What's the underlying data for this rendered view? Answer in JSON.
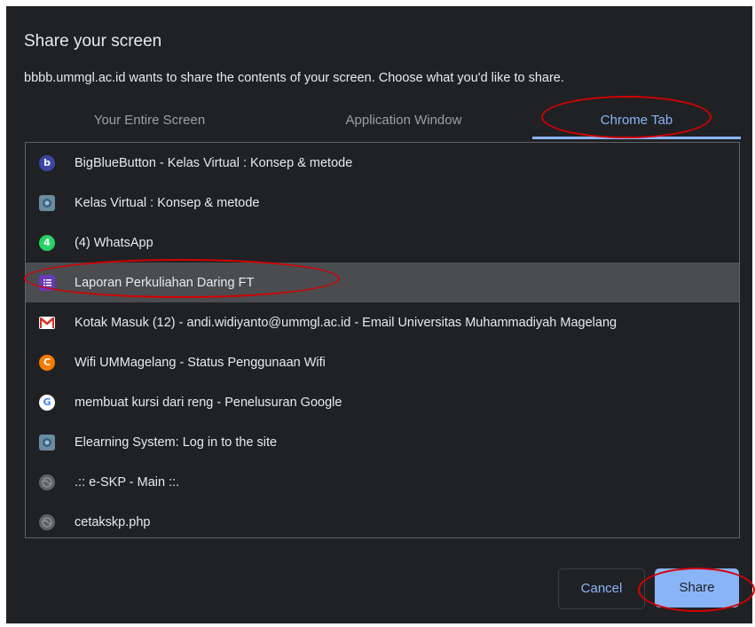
{
  "dialog": {
    "title": "Share your screen",
    "subtitle": "bbbb.ummgl.ac.id wants to share the contents of your screen. Choose what you'd like to share."
  },
  "tabs": [
    {
      "label": "Your Entire Screen",
      "active": false
    },
    {
      "label": "Application Window",
      "active": false
    },
    {
      "label": "Chrome Tab",
      "active": true
    }
  ],
  "tab_list": [
    {
      "label": "BigBlueButton - Kelas Virtual : Konsep & metode",
      "icon": "bigbluebutton-icon",
      "selected": false
    },
    {
      "label": "Kelas Virtual : Konsep & metode",
      "icon": "moodle-site-icon",
      "selected": false
    },
    {
      "label": "(4) WhatsApp",
      "icon": "whatsapp-icon",
      "selected": false
    },
    {
      "label": "Laporan Perkuliahan Daring FT",
      "icon": "google-forms-icon",
      "selected": true
    },
    {
      "label": "Kotak Masuk (12) - andi.widiyanto@ummgl.ac.id - Email Universitas Muhammadiyah Magelang",
      "icon": "gmail-icon",
      "selected": false
    },
    {
      "label": "Wifi UMMagelang - Status Penggunaan Wifi",
      "icon": "wifi-portal-icon",
      "selected": false
    },
    {
      "label": "membuat kursi dari reng - Penelusuran Google",
      "icon": "google-icon",
      "selected": false
    },
    {
      "label": "Elearning System: Log in to the site",
      "icon": "moodle-site-icon",
      "selected": false
    },
    {
      "label": ".:: e-SKP - Main ::.",
      "icon": "globe-icon",
      "selected": false
    },
    {
      "label": "cetakskp.php",
      "icon": "globe-icon",
      "selected": false
    }
  ],
  "buttons": {
    "cancel": "Cancel",
    "share": "Share"
  },
  "colors": {
    "dialog_bg": "#202124",
    "accent": "#8ab4f8",
    "selected_row": "#4a4c50",
    "annotation": "#d50000"
  }
}
